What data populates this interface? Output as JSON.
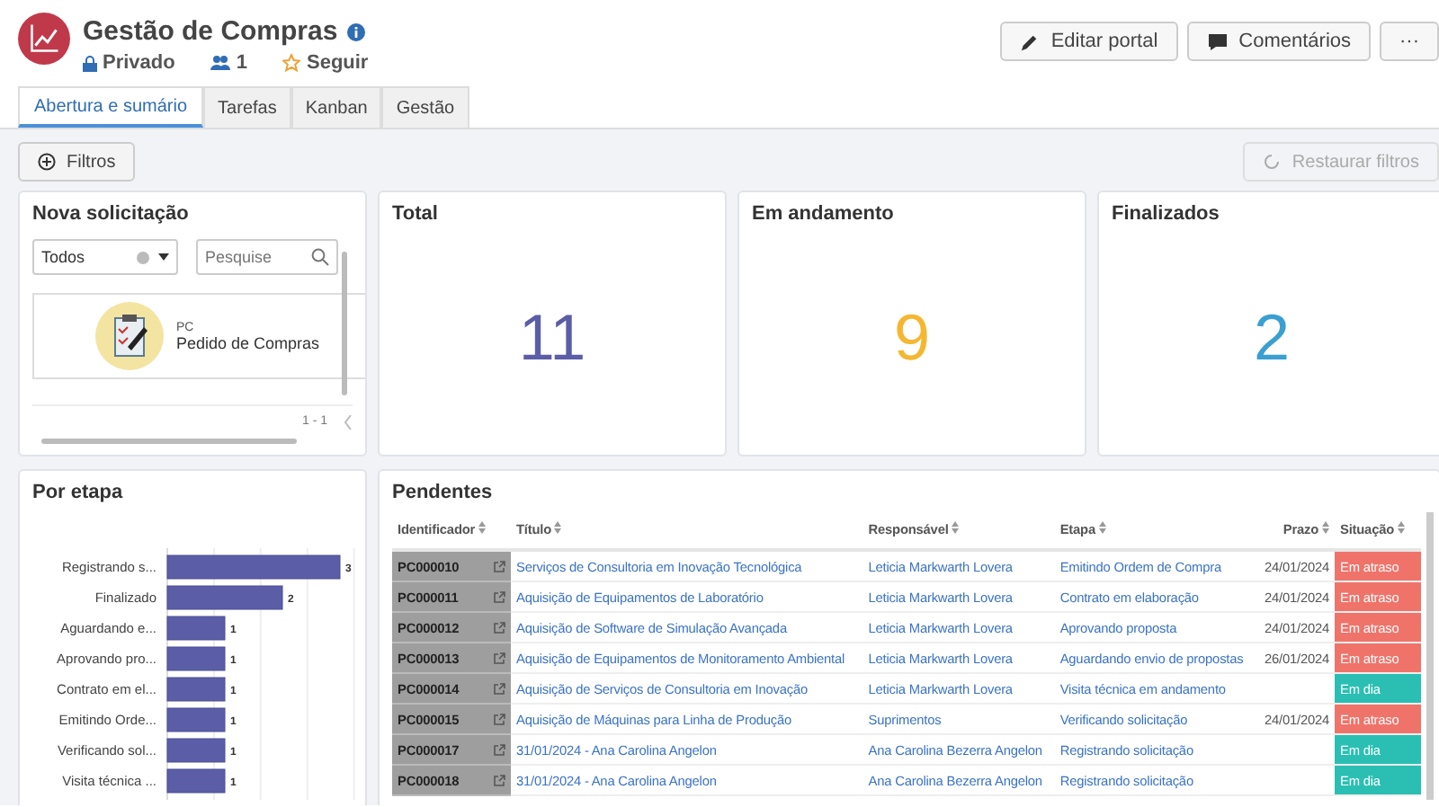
{
  "header": {
    "title": "Gestão de Compras",
    "visibility": "Privado",
    "members": "1",
    "follow": "Seguir",
    "buttons": [
      {
        "kind": "edit",
        "label": "Editar portal"
      },
      {
        "kind": "comments",
        "label": "Comentários"
      },
      {
        "kind": "more",
        "label": "···"
      }
    ]
  },
  "tabs": [
    {
      "label": "Abertura e sumário",
      "selected": true
    },
    {
      "label": "Tarefas",
      "selected": false
    },
    {
      "label": "Kanban",
      "selected": false
    },
    {
      "label": "Gestão",
      "selected": false
    }
  ],
  "toolbar": {
    "filters": "Filtros",
    "reset": "Restaurar filtros",
    "reset_disabled": true
  },
  "new_request": {
    "title": "Nova solicitação",
    "filter_value": "Todos",
    "search_placeholder": "Pesquise",
    "items": [
      {
        "code": "PC",
        "name": "Pedido de Compras"
      }
    ],
    "pagination": "1 - 1"
  },
  "stats": [
    {
      "title": "Total",
      "value": "11",
      "color": "#5b5ea6"
    },
    {
      "title": "Em andamento",
      "value": "9",
      "color": "#f5b731"
    },
    {
      "title": "Finalizados",
      "value": "2",
      "color": "#3a9fd1"
    }
  ],
  "by_stage": {
    "title": "Por etapa",
    "chart_data": {
      "type": "bar",
      "orientation": "horizontal",
      "categories": [
        "Registrando s...",
        "Finalizado",
        "Aguardando e...",
        "Aprovando pro...",
        "Contrato em el...",
        "Emitindo Orde...",
        "Verificando sol...",
        "Visita técnica ..."
      ],
      "series": [
        {
          "color": "#5b5ea6",
          "values": [
            3,
            2,
            1,
            1,
            1,
            1,
            1,
            1
          ]
        }
      ],
      "data_labels": true
    }
  },
  "pending": {
    "title": "Pendentes",
    "columns": [
      "Identificador",
      "Título",
      "Responsável",
      "Etapa",
      "Prazo",
      "Situação"
    ],
    "rows": [
      {
        "id": "PC000010",
        "title": "Serviços de Consultoria em Inovação Tecnológica",
        "owner": "Leticia Markwarth Lovera",
        "stage": "Emitindo Ordem de Compra",
        "due": "24/01/2024",
        "status": "Em atraso",
        "color": "#f0736a"
      },
      {
        "id": "PC000011",
        "title": "Aquisição de Equipamentos de Laboratório",
        "owner": "Leticia Markwarth Lovera",
        "stage": "Contrato em elaboração",
        "due": "24/01/2024",
        "status": "Em atraso",
        "color": "#f0736a"
      },
      {
        "id": "PC000012",
        "title": "Aquisição de Software de Simulação Avançada",
        "owner": "Leticia Markwarth Lovera",
        "stage": "Aprovando proposta",
        "due": "24/01/2024",
        "status": "Em atraso",
        "color": "#f0736a"
      },
      {
        "id": "PC000013",
        "title": "Aquisição de Equipamentos de Monitoramento Ambiental",
        "owner": "Leticia Markwarth Lovera",
        "stage": "Aguardando envio de propostas",
        "due": "26/01/2024",
        "status": "Em atraso",
        "color": "#f0736a"
      },
      {
        "id": "PC000014",
        "title": "Aquisição de Serviços de Consultoria em Inovação",
        "owner": "Leticia Markwarth Lovera",
        "stage": "Visita técnica em andamento",
        "status": "Em dia",
        "color": "#2bbfb3"
      },
      {
        "id": "PC000015",
        "title": "Aquisição de Máquinas para Linha de Produção",
        "owner": "Suprimentos",
        "stage": "Verificando solicitação",
        "due": "24/01/2024",
        "status": "Em atraso",
        "color": "#f0736a"
      },
      {
        "id": "PC000017",
        "title": "31/01/2024 - Ana Carolina Angelon",
        "owner": "Ana Carolina Bezerra Angelon",
        "stage": "Registrando solicitação",
        "status": "Em dia",
        "color": "#2bbfb3"
      },
      {
        "id": "PC000018",
        "title": "31/01/2024 - Ana Carolina Angelon",
        "owner": "Ana Carolina Bezerra Angelon",
        "stage": "Registrando solicitação",
        "status": "Em dia",
        "color": "#2bbfb3"
      }
    ]
  }
}
